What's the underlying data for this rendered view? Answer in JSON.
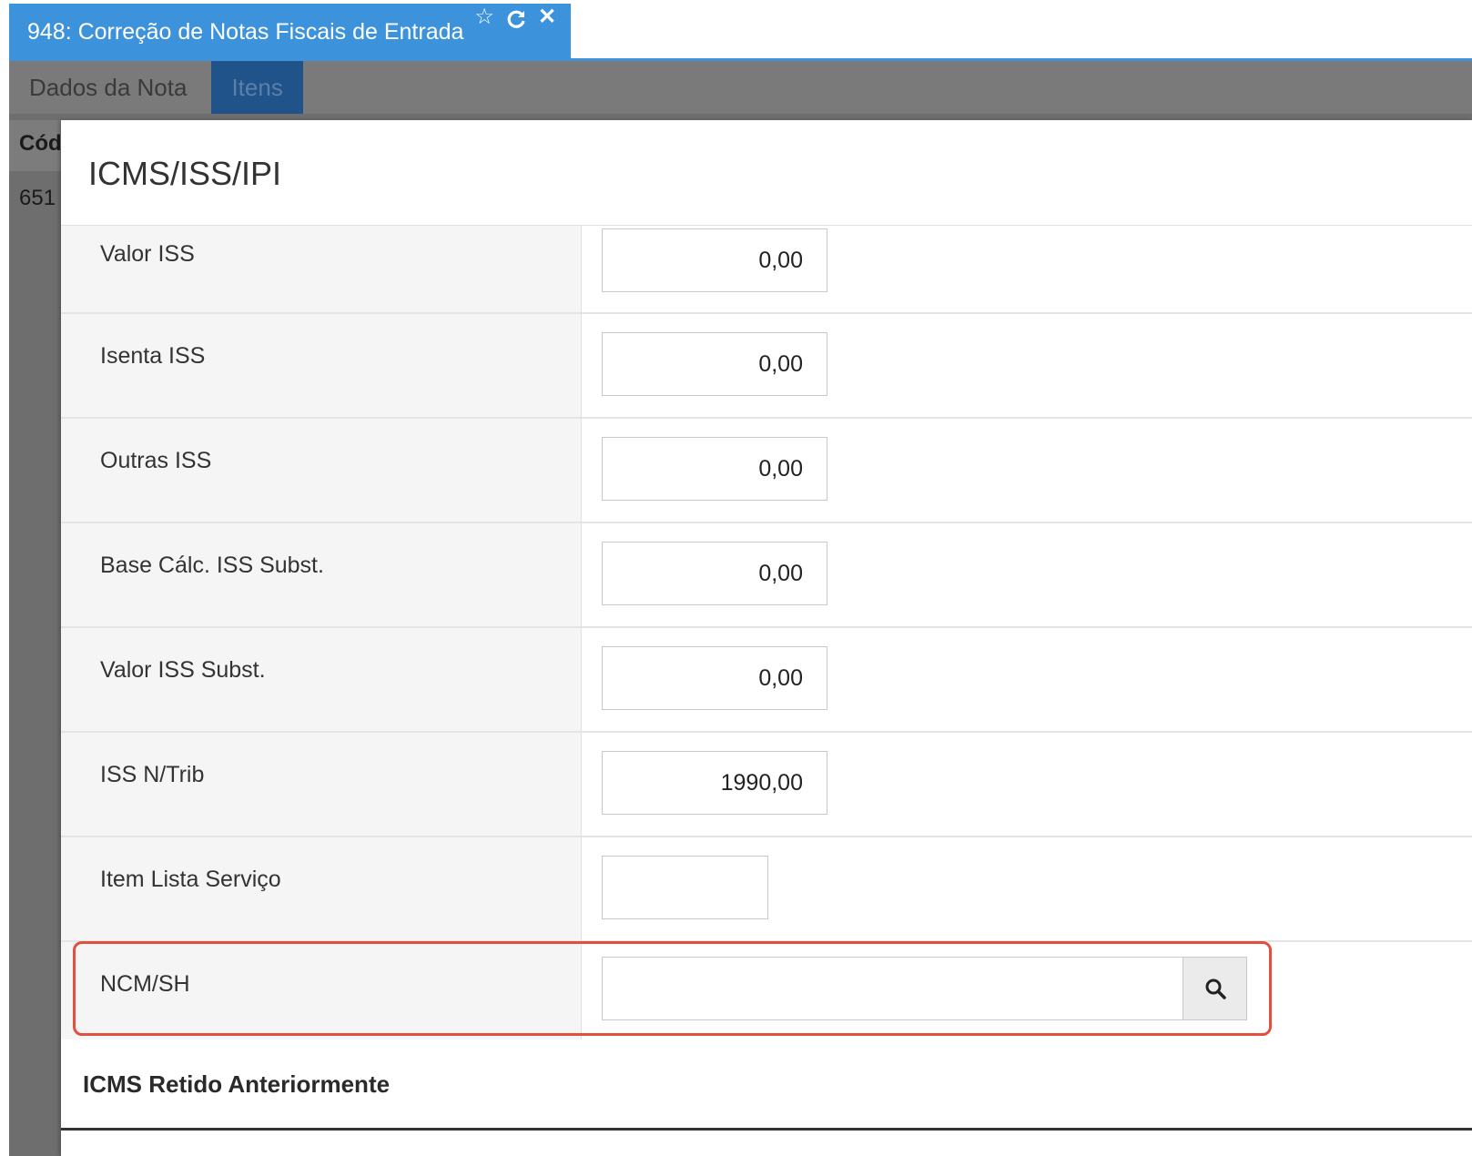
{
  "window": {
    "title": "948: Correção de Notas Fiscais de Entrada",
    "icons": [
      "star-icon",
      "refresh-icon",
      "close-icon"
    ],
    "accent_color": "#3d92dc"
  },
  "tabs": [
    {
      "label": "Dados da Nota",
      "active": false
    },
    {
      "label": "Itens",
      "active": true
    }
  ],
  "grid": {
    "header": "Cód",
    "first_cell": "651"
  },
  "modal": {
    "title": "ICMS/ISS/IPI",
    "rows": [
      {
        "label": "Valor ISS",
        "value": "0,00"
      },
      {
        "label": "Isenta ISS",
        "value": "0,00"
      },
      {
        "label": "Outras ISS",
        "value": "0,00"
      },
      {
        "label": "Base Cálc. ISS Subst.",
        "value": "0,00"
      },
      {
        "label": "Valor ISS Subst.",
        "value": "0,00"
      },
      {
        "label": "ISS N/Trib",
        "value": "1990,00"
      },
      {
        "label": "Item Lista Serviço",
        "value": ""
      },
      {
        "label": "NCM/SH",
        "value": ""
      }
    ],
    "section_title": "ICMS Retido Anteriormente",
    "highlight_color": "#e0503f"
  }
}
